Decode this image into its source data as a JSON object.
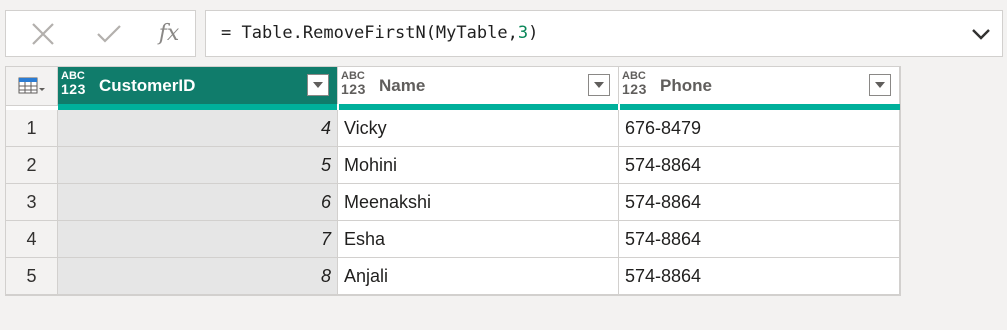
{
  "formula_bar": {
    "cancel_icon": "x-icon",
    "confirm_icon": "check-icon",
    "fx_label": "fx",
    "formula_prefix": "= Table.RemoveFirstN(MyTable,",
    "formula_number": "3",
    "formula_suffix": ")"
  },
  "grid": {
    "columns": [
      {
        "type_abc": "ABC",
        "type_123": "123",
        "label": "CustomerID"
      },
      {
        "type_abc": "ABC",
        "type_123": "123",
        "label": "Name"
      },
      {
        "type_abc": "ABC",
        "type_123": "123",
        "label": "Phone"
      }
    ],
    "rows": [
      {
        "num": "1",
        "customer_id": "4",
        "name": "Vicky",
        "phone": "676-8479"
      },
      {
        "num": "2",
        "customer_id": "5",
        "name": "Mohini",
        "phone": "574-8864"
      },
      {
        "num": "3",
        "customer_id": "6",
        "name": "Meenakshi",
        "phone": "574-8864"
      },
      {
        "num": "4",
        "customer_id": "7",
        "name": "Esha",
        "phone": "574-8864"
      },
      {
        "num": "5",
        "customer_id": "8",
        "name": "Anjali",
        "phone": "574-8864"
      }
    ]
  },
  "colors": {
    "selected_header": "#107c6b",
    "quality_bar": "#00b09b",
    "formula_number": "#098658"
  }
}
